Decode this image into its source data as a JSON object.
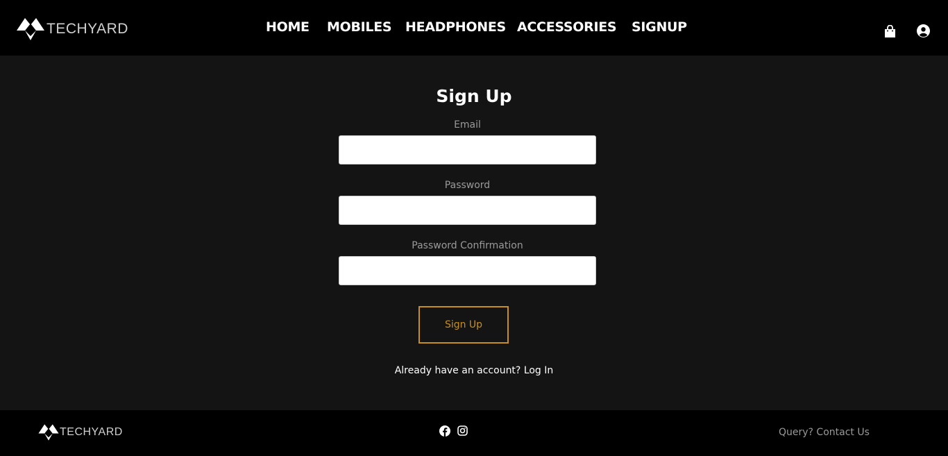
{
  "brand": {
    "name": "TECHYARD",
    "logo_icon": "techyard-logo-icon"
  },
  "nav": {
    "links": [
      {
        "label": "HOME"
      },
      {
        "label": "MOBILES"
      },
      {
        "label": "HEADPHONES"
      },
      {
        "label": "ACCESSORIES"
      },
      {
        "label": "SIGNUP"
      }
    ],
    "icons": [
      "shopping-bag-icon",
      "user-account-icon"
    ]
  },
  "form": {
    "title": "Sign Up",
    "fields": [
      {
        "label": "Email",
        "value": "",
        "placeholder": ""
      },
      {
        "label": "Password",
        "value": "",
        "placeholder": ""
      },
      {
        "label": "Password Confirmation",
        "value": "",
        "placeholder": ""
      }
    ],
    "submit_label": "Sign Up",
    "login_prompt": "Already have an account?",
    "login_link": "Log In"
  },
  "footer": {
    "brand": "TECHYARD",
    "social_icons": [
      "facebook-icon",
      "instagram-icon"
    ],
    "contact": "Query? Contact Us"
  },
  "colors": {
    "header_bg": "#000000",
    "page_bg": "#141414",
    "accent": "#c7901c",
    "muted_text": "#9a9a9a"
  }
}
